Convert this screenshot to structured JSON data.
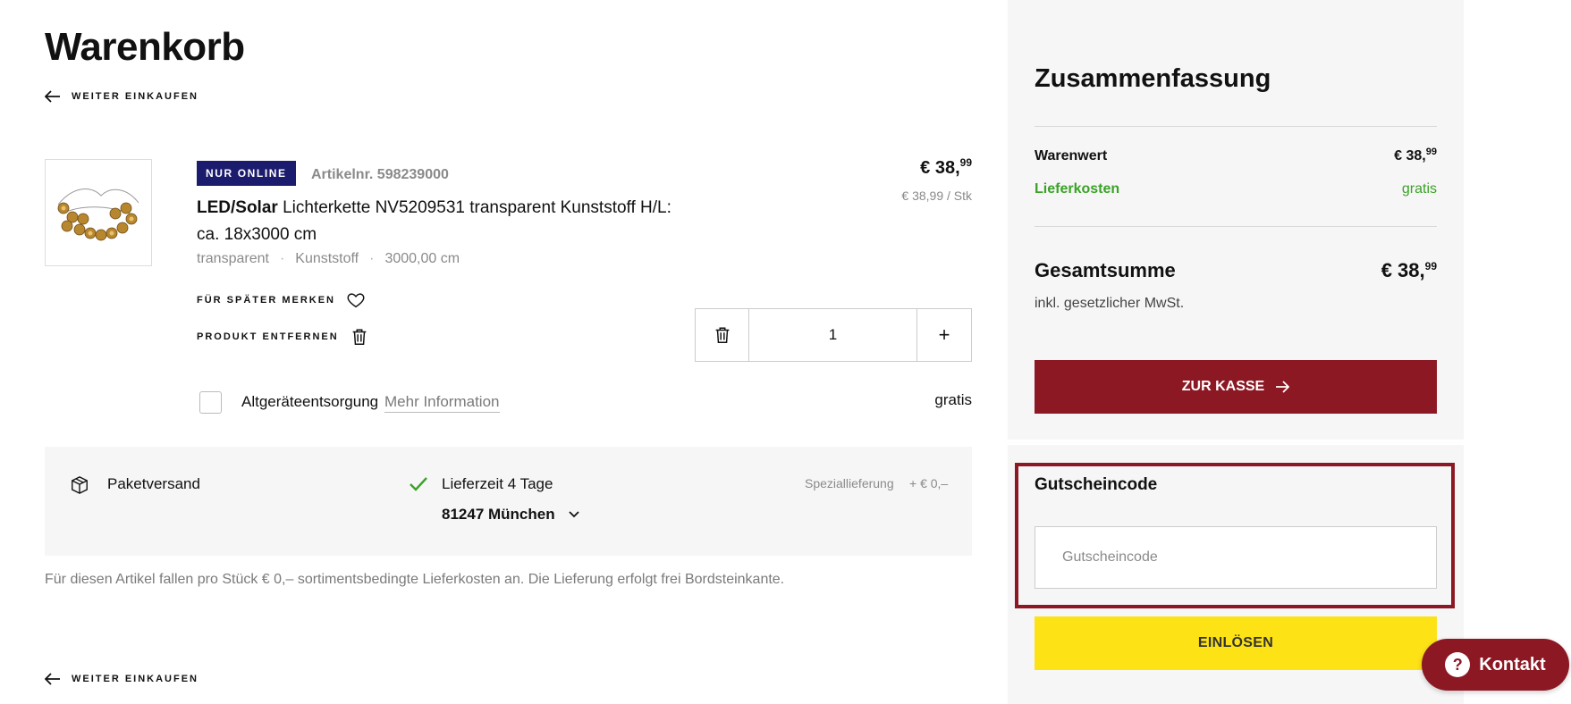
{
  "page": {
    "title": "Warenkorb",
    "back_link": "WEITER EINKAUFEN"
  },
  "item": {
    "badge": "NUR ONLINE",
    "article_no": "Artikelnr. 598239000",
    "title_bold": "LED/Solar",
    "title_rest": " Lichterkette NV5209531 transparent Kunststoff H/L: ca. 18x3000 cm",
    "attributes": [
      "transparent",
      "Kunststoff",
      "3000,00 cm"
    ],
    "attr_separator": "·",
    "price_main": "€ 38,",
    "price_cents": "99",
    "price_unit": "€ 38,99 / Stk",
    "save_label": "FÜR SPÄTER MERKEN",
    "remove_label": "PRODUKT ENTFERNEN",
    "quantity": "1",
    "qty_plus": "+",
    "disposal_label": "Altgeräteentsorgung",
    "disposal_more": "Mehr Information",
    "disposal_price": "gratis"
  },
  "shipping": {
    "method": "Paketversand",
    "delivery_time": "Lieferzeit 4 Tage",
    "zip": "81247 München",
    "special_label": "Speziallieferung",
    "special_price": "+ € 0,–",
    "note": "Für diesen Artikel fallen pro Stück € 0,– sortimentsbedingte Lieferkosten an. Die Lieferung erfolgt frei Bordsteinkante."
  },
  "summary": {
    "title": "Zusammenfassung",
    "goods_label": "Warenwert",
    "goods_main": "€ 38,",
    "goods_cents": "99",
    "delivery_label": "Lieferkosten",
    "delivery_value": "gratis",
    "total_label": "Gesamtsumme",
    "total_main": "€ 38,",
    "total_cents": "99",
    "vat_note": "inkl. gesetzlicher MwSt.",
    "checkout_label": "ZUR KASSE",
    "voucher_title": "Gutscheincode",
    "voucher_placeholder": "Gutscheincode",
    "redeem_label": "EINLÖSEN"
  },
  "contact": {
    "label": "Kontakt",
    "icon_glyph": "?"
  },
  "colors": {
    "brand_red": "#8c1823",
    "badge_navy": "#1c1c6e",
    "redeem_yellow": "#fde216",
    "free_green": "#3aa227"
  },
  "icons": [
    "arrow-left-icon",
    "heart-icon",
    "trash-icon",
    "package-icon",
    "checkmark-icon",
    "chevron-down-icon",
    "arrow-right-icon",
    "question-icon"
  ]
}
